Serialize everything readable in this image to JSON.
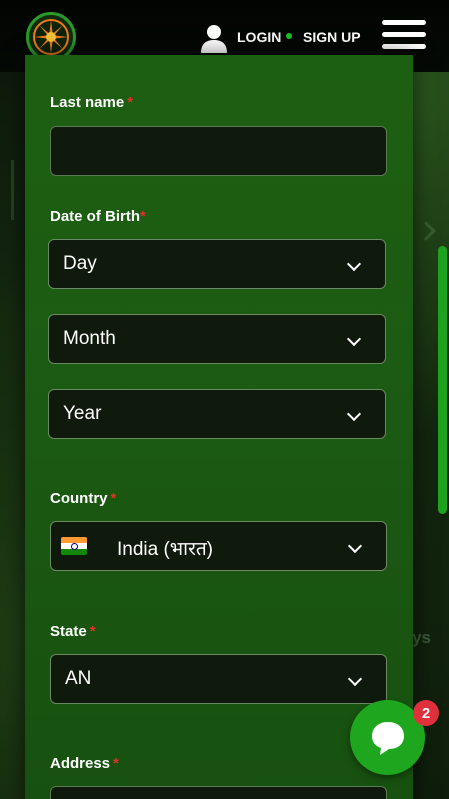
{
  "header": {
    "login_label": "LOGIN",
    "signup_label": "SIGN UP"
  },
  "form": {
    "last_name": {
      "label": "Last name",
      "required_mark": "*",
      "value": ""
    },
    "dob": {
      "label": "Date of Birth",
      "required_mark": "*",
      "day": "Day",
      "month": "Month",
      "year": "Year"
    },
    "country": {
      "label": "Country",
      "required_mark": "*",
      "value": "India (भारत)",
      "flag": "india-flag"
    },
    "state": {
      "label": "State",
      "required_mark": "*",
      "value": "AN"
    },
    "address": {
      "label": "Address",
      "required_mark": "*"
    }
  },
  "chat": {
    "badge_count": "2"
  },
  "background": {
    "side_text": "ys"
  },
  "colors": {
    "panel_green": "#1d5f12",
    "accent_green": "#1ea71e",
    "required_red": "#e0302c",
    "badge_red": "#e0303c"
  }
}
